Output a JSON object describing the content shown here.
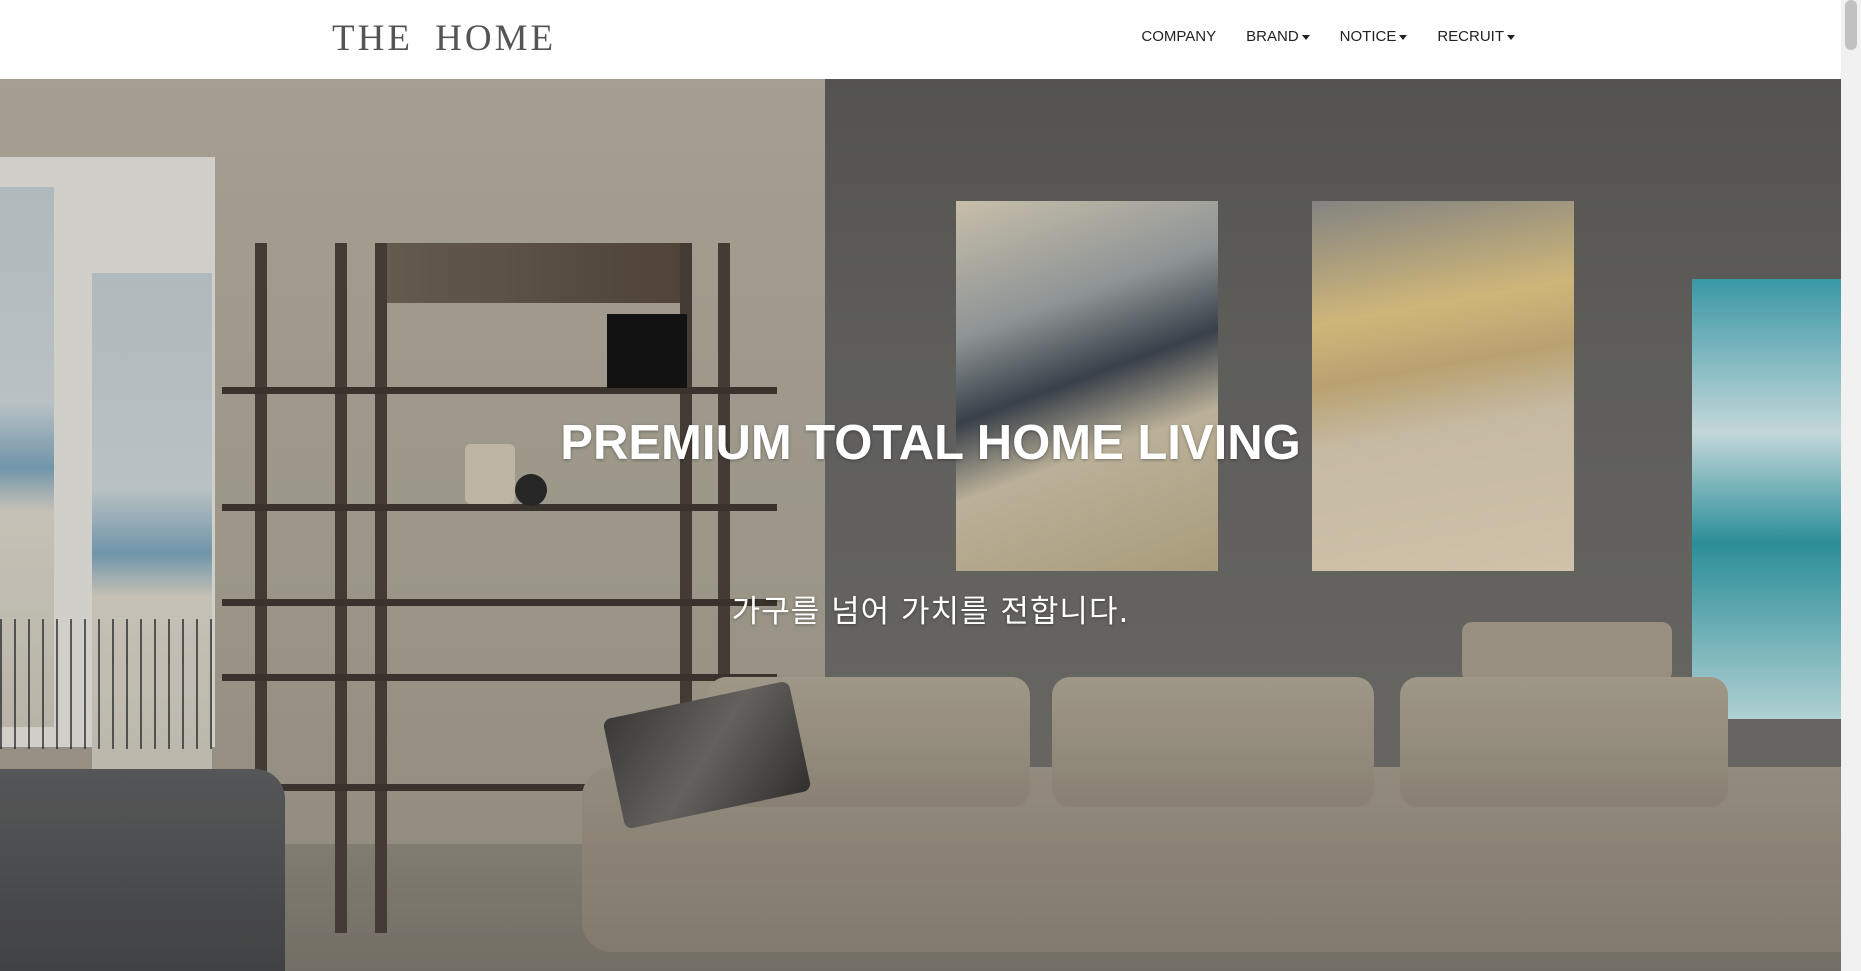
{
  "header": {
    "logo": "THE HOME",
    "nav": [
      {
        "label": "COMPANY",
        "dropdown": false
      },
      {
        "label": "BRAND",
        "dropdown": true
      },
      {
        "label": "NOTICE",
        "dropdown": true
      },
      {
        "label": "RECRUIT",
        "dropdown": true
      }
    ]
  },
  "hero": {
    "title": "PREMIUM TOTAL HOME LIVING",
    "subtitle": "가구를 넘어 가치를 전합니다."
  }
}
